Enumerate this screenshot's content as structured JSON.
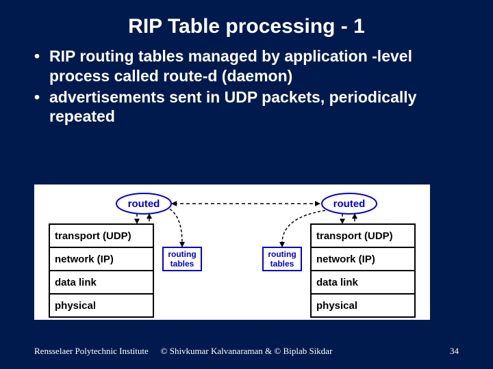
{
  "title": "RIP Table processing - 1",
  "bullets": [
    "RIP routing tables managed by application -level process called route-d (daemon)",
    "advertisements sent in UDP packets, periodically repeated"
  ],
  "diagram": {
    "node_label": "routed",
    "tables_label_line1": "routing",
    "tables_label_line2": "tables",
    "layers": [
      "transport (UDP)",
      "network (IP)",
      "data link",
      "physical"
    ]
  },
  "footer": {
    "left": "Rensselaer Polytechnic Institute",
    "center": "© Shivkumar Kalvanaraman   &   © Biplab Sikdar",
    "right": "34"
  }
}
